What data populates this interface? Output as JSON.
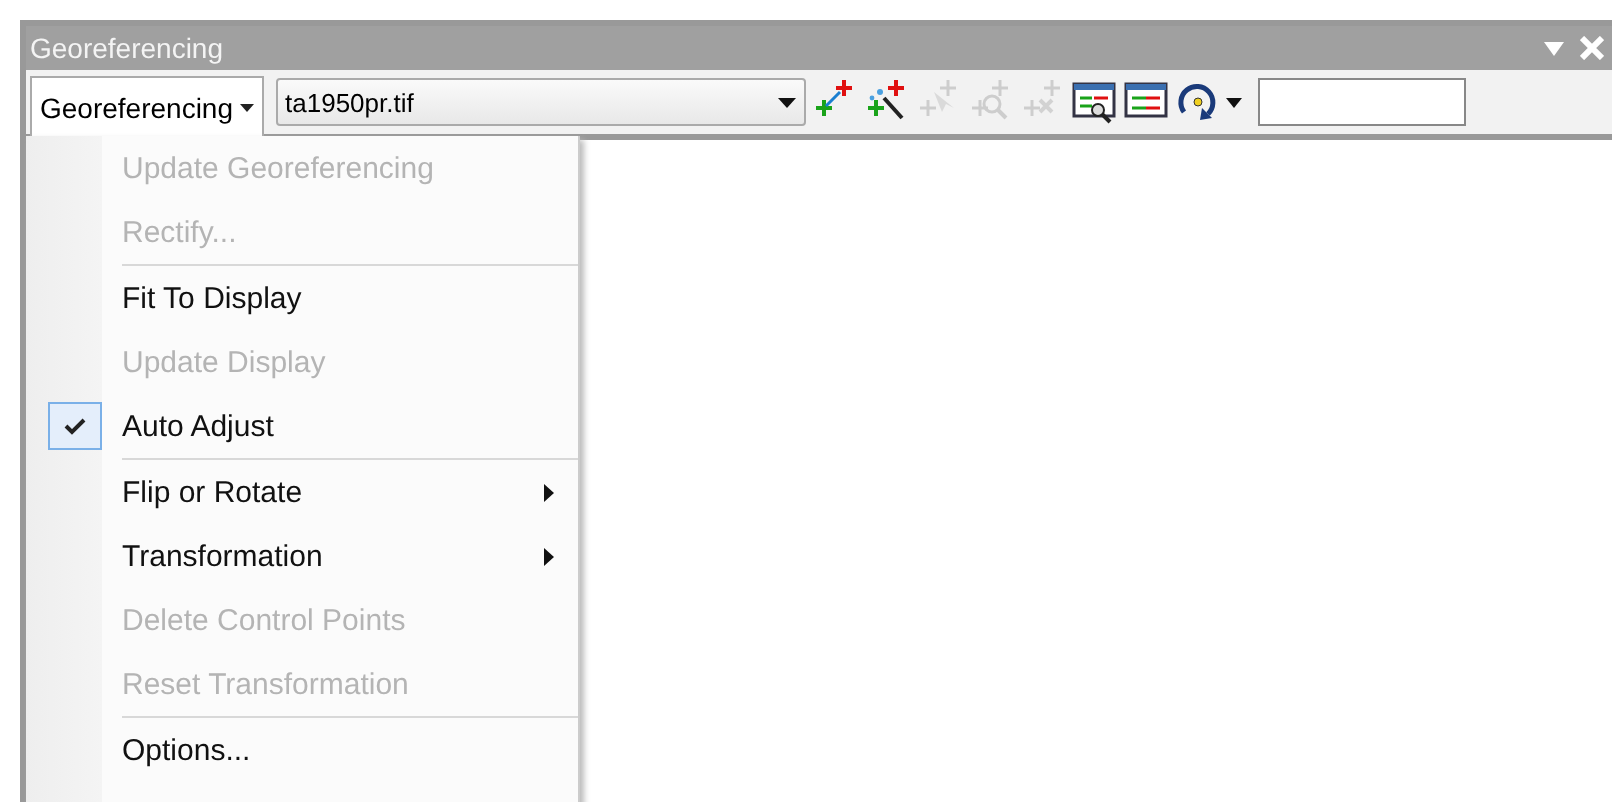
{
  "window": {
    "title": "Georeferencing"
  },
  "toolbar": {
    "menu_button": "Georeferencing",
    "layer": "ta1950pr.tif",
    "tools": [
      {
        "kind": "add-points",
        "disabled": false
      },
      {
        "kind": "auto-points",
        "disabled": false
      },
      {
        "kind": "select-point",
        "disabled": true
      },
      {
        "kind": "zoom-point",
        "disabled": true
      },
      {
        "kind": "delete-point",
        "disabled": true
      },
      {
        "kind": "zoom-table",
        "disabled": false
      },
      {
        "kind": "link-table",
        "disabled": false
      },
      {
        "kind": "rotate",
        "disabled": false
      }
    ]
  },
  "menu": {
    "groups": [
      {
        "items": [
          {
            "label": "Update Georeferencing",
            "disabled": true,
            "checked": false,
            "submenu": false
          },
          {
            "label": "Rectify...",
            "disabled": true,
            "checked": false,
            "submenu": false
          }
        ]
      },
      {
        "items": [
          {
            "label": "Fit To Display",
            "disabled": false,
            "checked": false,
            "submenu": false
          },
          {
            "label": "Update Display",
            "disabled": true,
            "checked": false,
            "submenu": false
          },
          {
            "label": "Auto Adjust",
            "disabled": false,
            "checked": true,
            "submenu": false
          }
        ]
      },
      {
        "items": [
          {
            "label": "Flip or Rotate",
            "disabled": false,
            "checked": false,
            "submenu": true
          },
          {
            "label": "Transformation",
            "disabled": false,
            "checked": false,
            "submenu": true
          },
          {
            "label": "Delete Control Points",
            "disabled": true,
            "checked": false,
            "submenu": false
          },
          {
            "label": "Reset Transformation",
            "disabled": true,
            "checked": false,
            "submenu": false
          }
        ]
      },
      {
        "items": [
          {
            "label": "Options...",
            "disabled": false,
            "checked": false,
            "submenu": false
          }
        ]
      }
    ]
  }
}
